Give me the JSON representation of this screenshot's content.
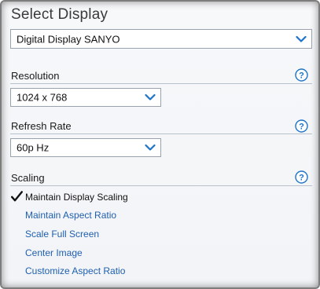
{
  "title": "Select Display",
  "display": {
    "selected": "Digital Display SANYO"
  },
  "resolution": {
    "label": "Resolution",
    "selected": "1024 x 768"
  },
  "refresh_rate": {
    "label": "Refresh Rate",
    "selected": "60p Hz"
  },
  "scaling": {
    "label": "Scaling",
    "options": [
      {
        "label": "Maintain Display Scaling",
        "selected": true
      },
      {
        "label": "Maintain Aspect Ratio",
        "selected": false
      },
      {
        "label": "Scale Full Screen",
        "selected": false
      },
      {
        "label": "Center Image",
        "selected": false
      },
      {
        "label": "Customize Aspect Ratio",
        "selected": false
      }
    ]
  },
  "icons": {
    "help": "help-icon",
    "dropdown": "chevron-down-icon",
    "check": "checkmark-icon"
  },
  "colors": {
    "link": "#1f5fae",
    "accent": "#1d73c9"
  }
}
